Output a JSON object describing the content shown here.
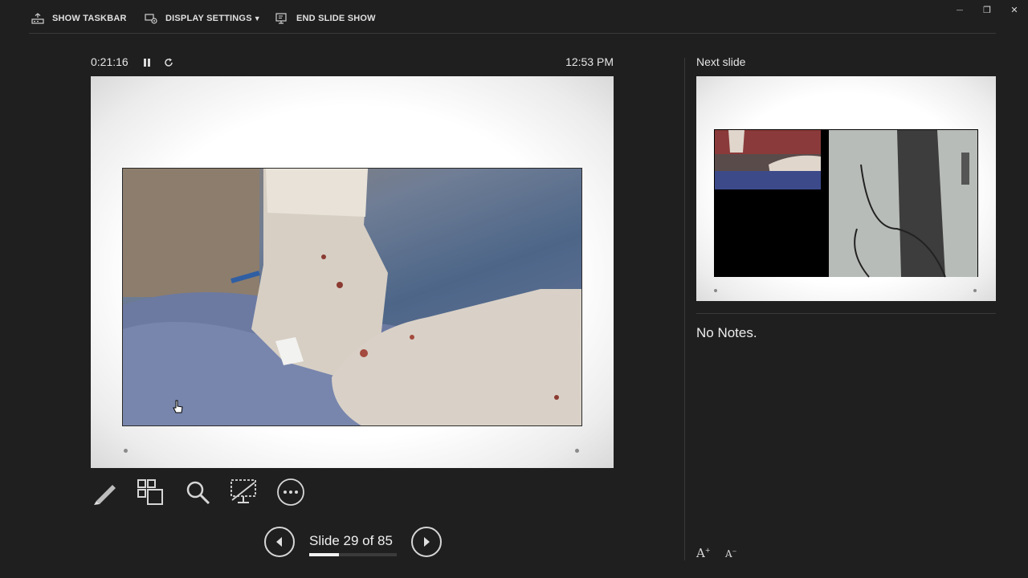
{
  "toolbar": {
    "show_taskbar": "SHOW TASKBAR",
    "display_settings": "DISPLAY SETTINGS",
    "display_settings_caret": "▼",
    "end_slide_show": "END SLIDE SHOW"
  },
  "window_controls": {
    "minimize": "—",
    "restore": "❐",
    "close": "✕"
  },
  "timer": {
    "elapsed": "0:21:16",
    "clock": "12:53 PM"
  },
  "icons": {
    "taskbar": "taskbar-icon",
    "display": "display-settings-icon",
    "end": "end-show-icon",
    "pause": "pause-icon",
    "restart": "restart-icon",
    "pen": "pen-icon",
    "all_slides": "see-all-slides-icon",
    "zoom": "zoom-icon",
    "black_screen": "black-screen-icon",
    "more": "more-options-icon",
    "prev": "previous-slide-icon",
    "next": "next-slide-icon"
  },
  "navigation": {
    "slide_label": "Slide 29 of 85",
    "current": 29,
    "total": 85
  },
  "next_pane": {
    "label": "Next slide"
  },
  "notes": {
    "text": "No Notes."
  },
  "font_controls": {
    "increase": "A",
    "decrease": "A"
  },
  "colors": {
    "background": "#1f1f1f",
    "text": "#e6e6e6",
    "divider": "#3a3a3a"
  }
}
